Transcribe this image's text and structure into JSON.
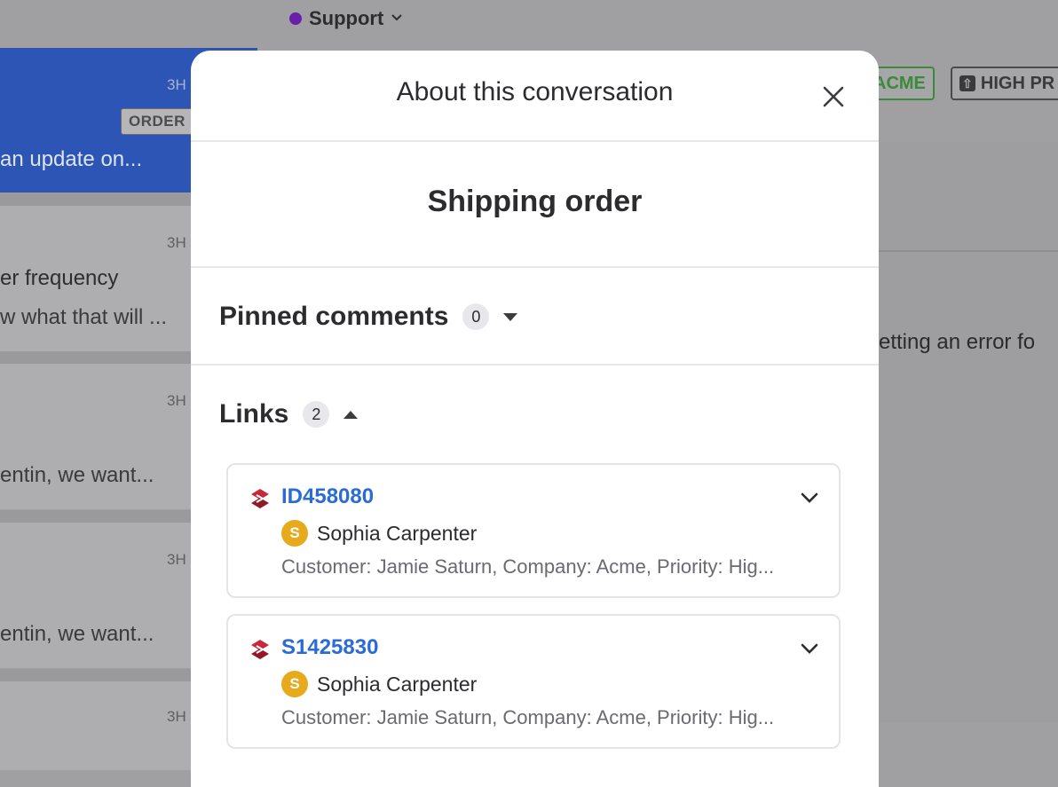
{
  "header": {
    "inbox_name": "Support"
  },
  "conversations": [
    {
      "time": "3H",
      "tag": "ORDER",
      "snippet": "an update on..."
    },
    {
      "time": "3H",
      "subject": "er frequency",
      "snippet": "w what that will ..."
    },
    {
      "time": "3H",
      "snippet": "entin, we want..."
    },
    {
      "time": "3H",
      "snippet": "entin, we want..."
    },
    {
      "time": "3H"
    }
  ],
  "right": {
    "tag_acme": "ACME",
    "tag_priority": "HIGH PR",
    "message": "etting an error fo"
  },
  "modal": {
    "title": "About this conversation",
    "subtitle": "Shipping order",
    "pinned": {
      "title": "Pinned comments",
      "count": "0"
    },
    "links": {
      "title": "Links",
      "count": "2",
      "items": [
        {
          "id": "ID458080",
          "avatar_letter": "S",
          "user": "Sophia Carpenter",
          "desc": "Customer: Jamie Saturn, Company: Acme, Priority: Hig..."
        },
        {
          "id": "S1425830",
          "avatar_letter": "S",
          "user": "Sophia Carpenter",
          "desc": "Customer: Jamie Saturn, Company: Acme, Priority: Hig..."
        }
      ]
    }
  },
  "colors": {
    "accent_blue": "#2b6bd6",
    "avatar_gold": "#e7aa1c",
    "inbox_dot": "#6a1fa8",
    "tag_green": "#3a8a3a",
    "logo_red": "#c8283a"
  }
}
